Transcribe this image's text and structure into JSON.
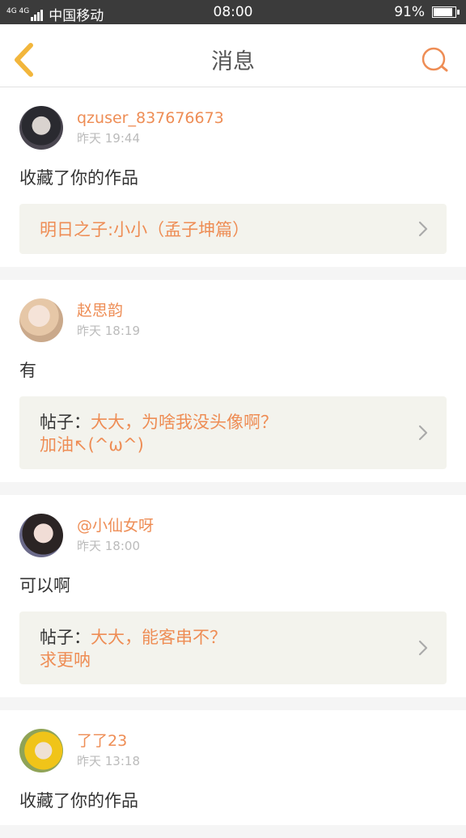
{
  "status_bar": {
    "network": "4G 4G",
    "carrier": "中国移动",
    "time": "08:00",
    "battery_level_percent": 91,
    "battery_text": "91%"
  },
  "nav": {
    "title": "消息",
    "back_icon": "chevron-left-icon",
    "search_icon": "search-icon",
    "accent_color": "#ee8d55"
  },
  "messages": [
    {
      "username": "qzuser_837676673",
      "time": "昨天 19:44",
      "text": "收藏了你的作品",
      "ref_prefix": "",
      "ref_text": "明日之子:小小（孟子坤篇）"
    },
    {
      "username": "赵思韵",
      "time": "昨天 18:19",
      "text": "有",
      "ref_prefix": "帖子：",
      "ref_text": "大大，为啥我没头像啊？\n加油↖(^ω^)"
    },
    {
      "username": "@小仙女呀",
      "time": "昨天 18:00",
      "text": "可以啊",
      "ref_prefix": "帖子：",
      "ref_text": "大大，能客串不？\n求更呐"
    },
    {
      "username": "了了23",
      "time": "昨天 13:18",
      "text": "收藏了你的作品",
      "ref_prefix": "",
      "ref_text": ""
    }
  ]
}
